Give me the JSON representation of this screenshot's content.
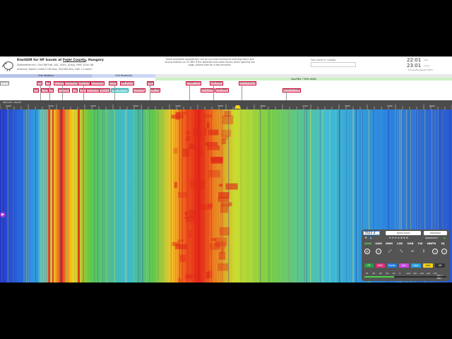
{
  "header": {
    "title_prefix": "KiwiSDR for HF bands at ",
    "title_county": "Fejér County",
    "title_suffix": ", Hungary",
    "line2": "Székesfehérvár | Grid JN97wd, ASL 135m, [map], RME 31/30 dB",
    "line3": "Antenna: Dipole (2x6m/17/8 long, 5m/18ft AGL) with 1:1 balun",
    "notice": "Some overloads sporadically can be occurred during the evening hours due strong stations on 41 MB! If the waterfall and audio stucks when opening the page, please wait for a few seconds!",
    "name_label": "Your name or callsign:",
    "name_placeholder": "",
    "utc_time": "22:01",
    "utc_label": "UTC",
    "local_time": "23:01",
    "local_label": "Local",
    "timezone": "Europe/Budapest (CET)"
  },
  "bands_top": [
    {
      "label": "41m Amateur",
      "color": "#b7c4ea"
    },
    {
      "label": "41m Broadcast",
      "color": "#ccd7f5"
    },
    {
      "label": "Gov/HWL 7 MHz Utility",
      "color": "#cdf2c6"
    }
  ],
  "stations_row1": [
    "RRI",
    "VOICE",
    "CRI",
    "R.SUDAN",
    "R.ROMANIA",
    "CRI/CGTN",
    "R.ROMANIA",
    "VOICE",
    "PBS Xizang",
    "RNZI",
    "R.FREE ASIA",
    "VOA DPRK",
    "Voice of Kenya"
  ],
  "stations_row2": [
    "ERI",
    "VOICE",
    "VOICE",
    "CRI",
    "ROMANIA",
    "CRI/CGTN",
    "R.ROMANIA",
    "National",
    "WRN Germany",
    "CRI/CGTN",
    "BBC WS",
    "Voice of Mr",
    "VOK DPRK",
    "ECHO OF HOPE"
  ],
  "stations_left": [
    "(Unkn)",
    "LSB"
  ],
  "scale": {
    "db_label": "dbmsim: stored",
    "ticks": [
      "7000",
      "7100",
      "7200",
      "7300",
      "7400",
      "7500",
      "7600",
      "7700",
      "7800",
      "7900",
      "8000"
    ]
  },
  "waterfall": {
    "side_label": "Aaaaaaaaaa"
  },
  "panel": {
    "frequency": "7622.4",
    "band_select": "select band",
    "ext_select": "extension",
    "spectrum": "Spectrum",
    "modes": [
      "AMN",
      "SAM",
      "DRM",
      "LSB",
      "USB",
      "CW",
      "NBFM",
      "IQ"
    ],
    "chips": [
      {
        "label": "RF",
        "color": "#2a9a43"
      },
      {
        "label": "NFS",
        "color": "#e0307a"
      },
      {
        "label": "Radio",
        "color": "#1f7ae0"
      },
      {
        "label": "AGC",
        "color": "#c844e0"
      },
      {
        "label": "User",
        "color": "#2aa0e0"
      },
      {
        "label": "Stat",
        "color": "#f2d21a"
      },
      {
        "label": "Off",
        "color": "#333333"
      }
    ],
    "slider_labels": [
      "50",
      "40",
      "30",
      "20",
      "10",
      "0",
      "+10",
      "+20",
      "+30",
      "+40",
      "+50"
    ],
    "db_readout": "-82.7",
    "db_unit": "dBm"
  }
}
